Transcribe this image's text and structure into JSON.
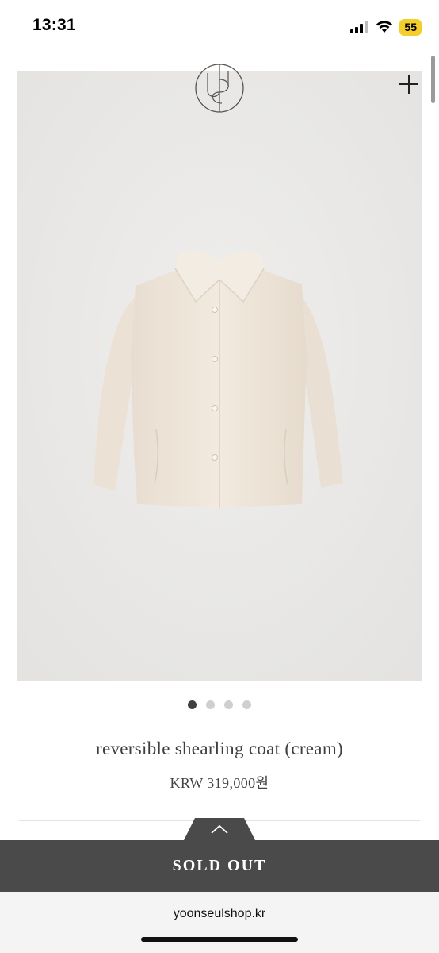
{
  "status_bar": {
    "time": "13:31",
    "battery_level": "55",
    "icons": [
      "signal-icon",
      "wifi-icon",
      "battery-icon"
    ]
  },
  "header": {
    "logo_icon": "brand-monogram-logo",
    "menu_icon": "plus-icon"
  },
  "gallery": {
    "image_subject": "cream shearling coat",
    "dot_count": 4,
    "active_index": 0
  },
  "product": {
    "title": "reversible shearling coat (cream)",
    "price": "KRW 319,000원"
  },
  "purchase": {
    "handle_icon": "chevron-up-icon",
    "sold_out_label": "SOLD OUT"
  },
  "browser": {
    "url": "yoonseulshop.kr"
  },
  "colors": {
    "image_background": "#eae9e7",
    "coat": "#efe6da",
    "sold_out_bar": "#4a4a4a",
    "battery": "#f4cf2c",
    "dot_active": "#3f3f3f",
    "dot_inactive": "#cfcfcf"
  }
}
